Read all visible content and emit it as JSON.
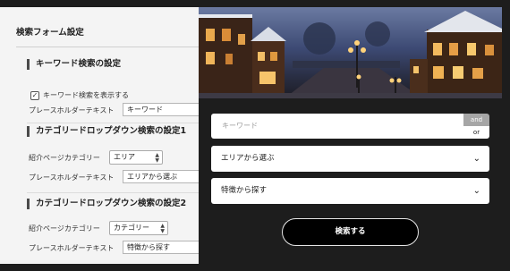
{
  "settings": {
    "title": "検索フォーム設定",
    "keyword_section": {
      "heading": "キーワード検索の設定",
      "show_checkbox_label": "キーワード検索を表示する",
      "show_checked": true,
      "placeholder_label": "プレースホルダーテキスト",
      "placeholder_value": "キーワード"
    },
    "category_dropdown_1": {
      "heading": "カテゴリードロップダウン検索の設定1",
      "category_label": "紹介ページカテゴリー",
      "category_value": "エリア",
      "placeholder_label": "プレースホルダーテキスト",
      "placeholder_value": "エリアから選ぶ"
    },
    "category_dropdown_2": {
      "heading": "カテゴリードロップダウン検索の設定2",
      "category_label": "紹介ページカテゴリー",
      "category_value": "カテゴリー",
      "placeholder_label": "プレースホルダーテキスト",
      "placeholder_value": "特徴から探す"
    }
  },
  "preview": {
    "keyword_placeholder": "キーワード",
    "and_label": "and",
    "or_label": "or",
    "area_dropdown": "エリアから選ぶ",
    "feature_dropdown": "特徴から探す",
    "search_button": "検索する"
  },
  "icons": {
    "checkbox": "checkmark-icon",
    "dropdown": "chevron-down-icon",
    "select": "up-down-arrows-icon"
  }
}
